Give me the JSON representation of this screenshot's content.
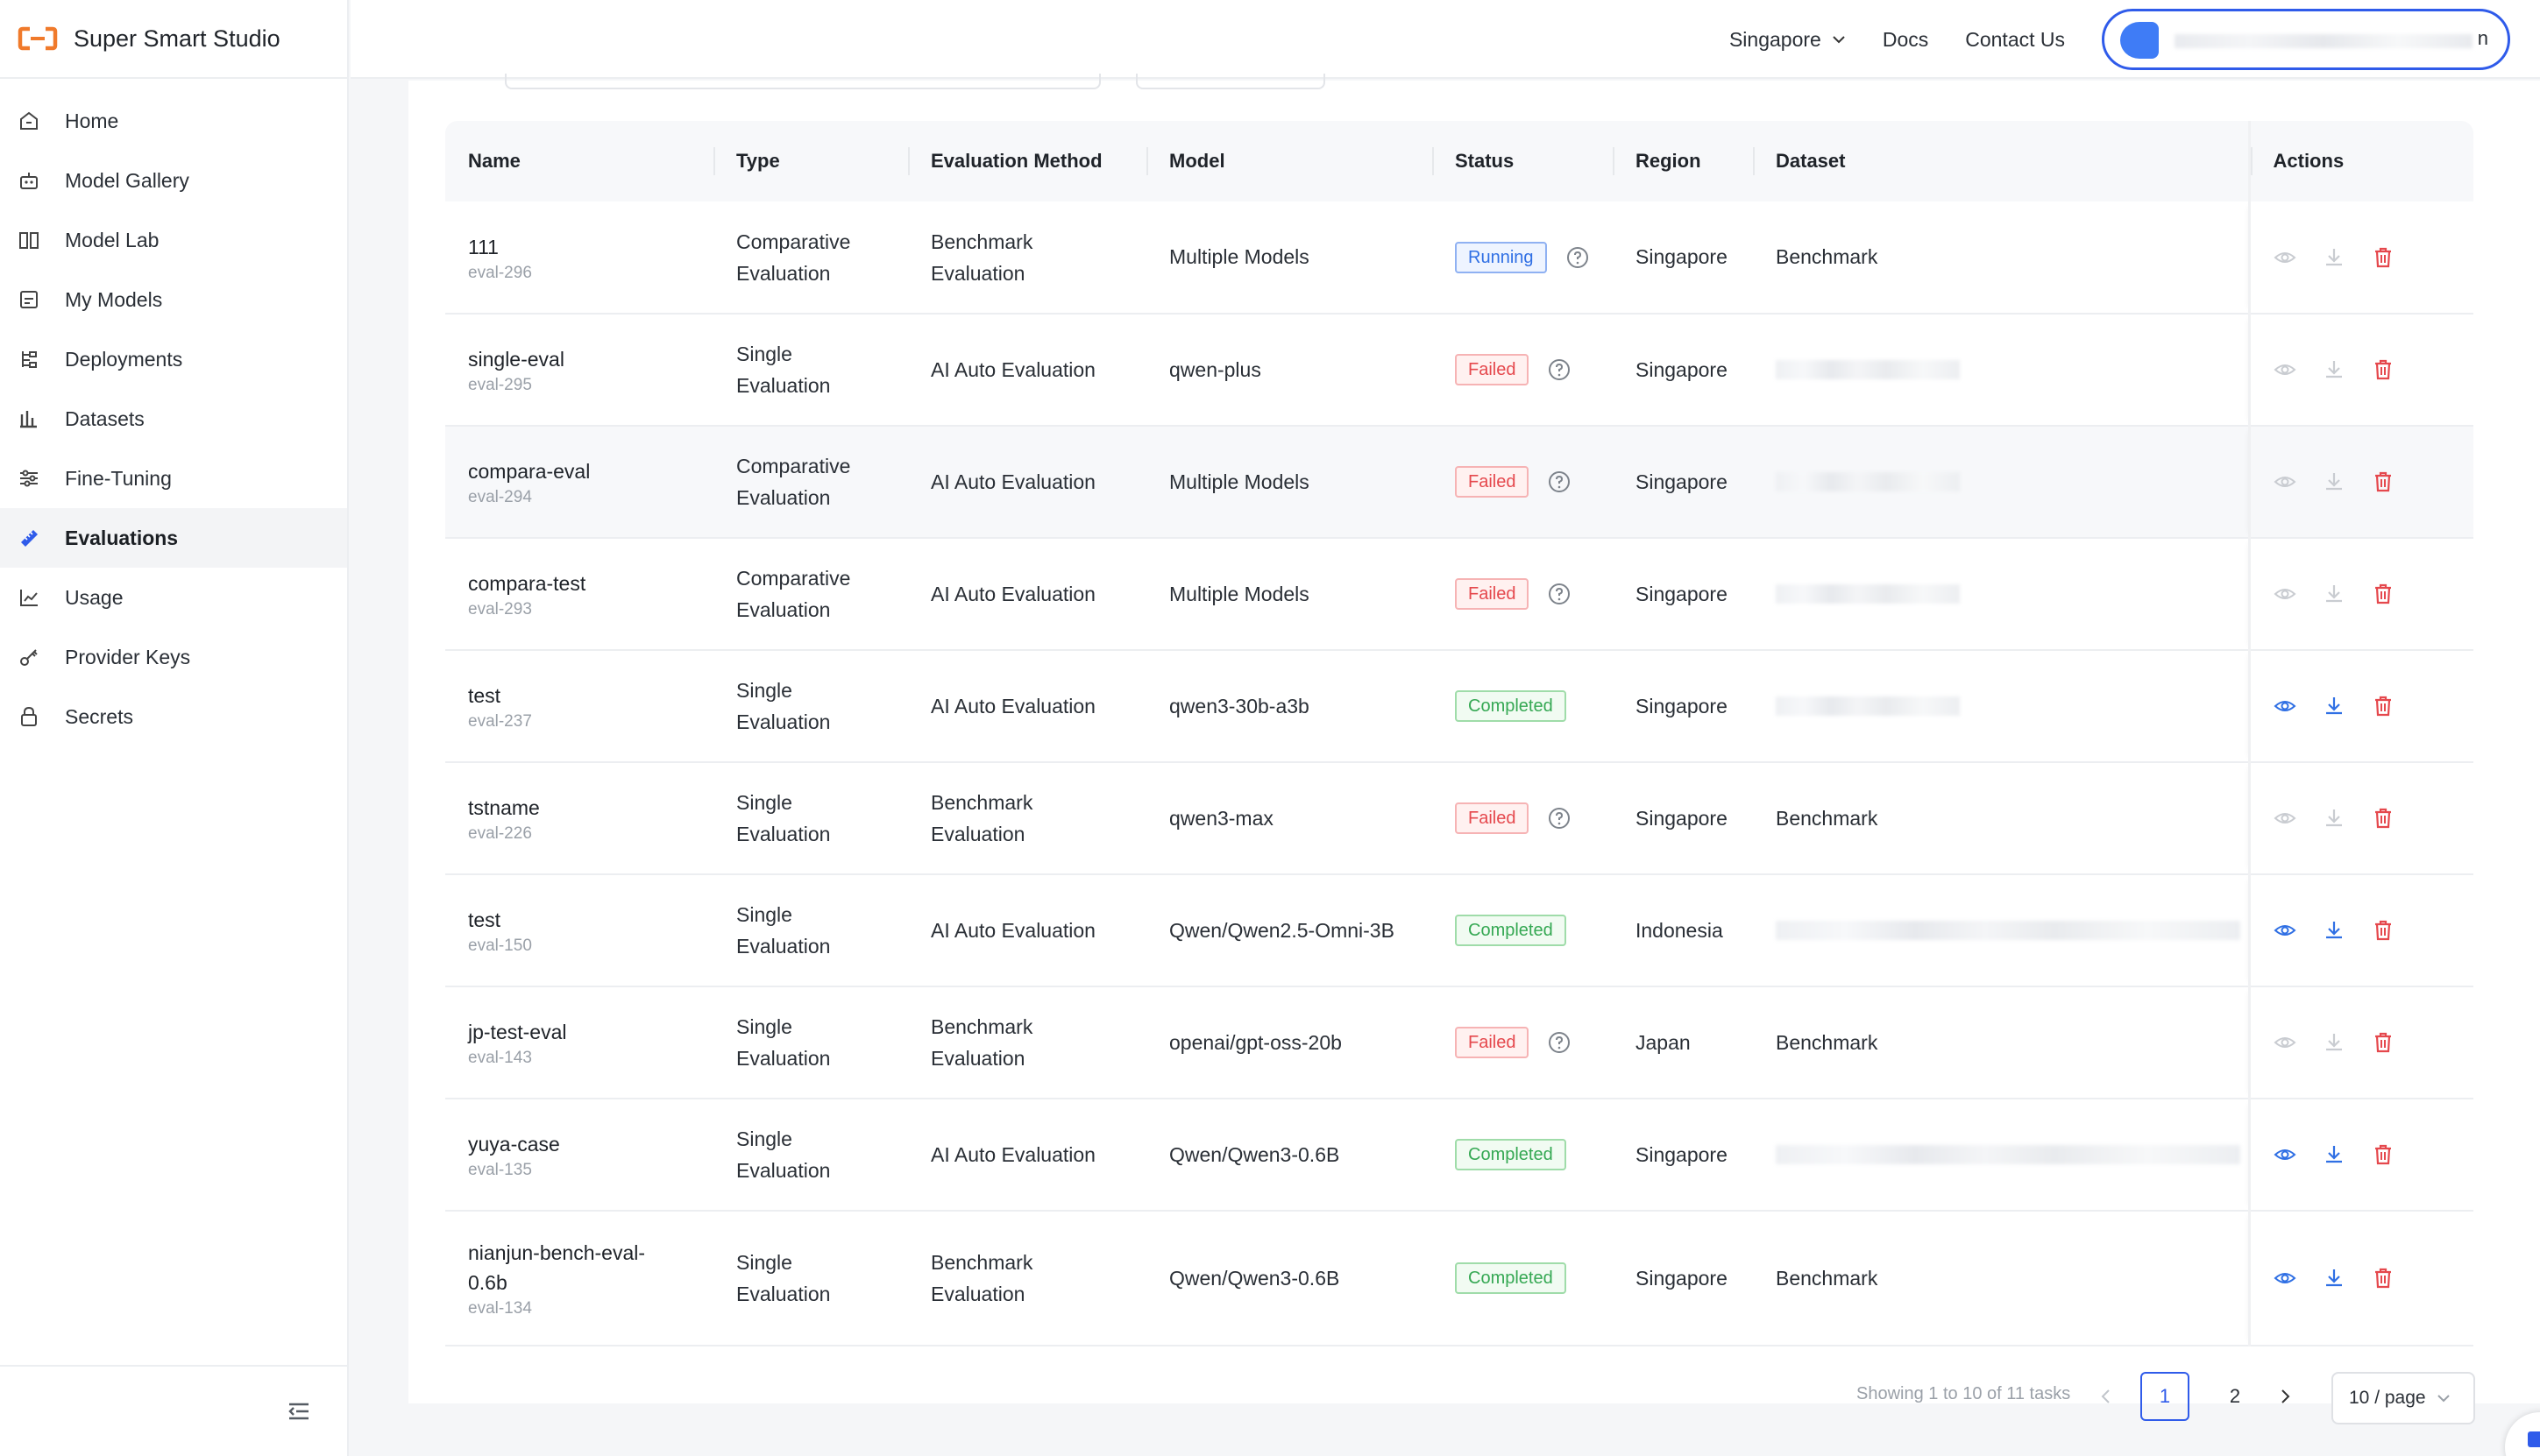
{
  "app": {
    "title": "Super Smart Studio"
  },
  "sidebar": {
    "items": [
      {
        "label": "Home",
        "icon": "home-icon"
      },
      {
        "label": "Model Gallery",
        "icon": "robot-icon"
      },
      {
        "label": "Model Lab",
        "icon": "book-icon"
      },
      {
        "label": "My Models",
        "icon": "model-icon"
      },
      {
        "label": "Deployments",
        "icon": "deploy-icon"
      },
      {
        "label": "Datasets",
        "icon": "chart-icon"
      },
      {
        "label": "Fine-Tuning",
        "icon": "sliders-icon"
      },
      {
        "label": "Evaluations",
        "icon": "ruler-icon",
        "active": true
      },
      {
        "label": "Usage",
        "icon": "usage-icon"
      },
      {
        "label": "Provider Keys",
        "icon": "key-icon"
      },
      {
        "label": "Secrets",
        "icon": "lock-icon"
      }
    ]
  },
  "header": {
    "region": "Singapore",
    "docs": "Docs",
    "contact": "Contact Us",
    "user_tail": "n"
  },
  "table": {
    "columns": [
      "Name",
      "Type",
      "Evaluation Method",
      "Model",
      "Status",
      "Region",
      "Dataset",
      "Actions"
    ],
    "rows": [
      {
        "name": "111",
        "id": "eval-296",
        "type": "Comparative Evaluation",
        "type1": "Comparative",
        "type2": "Evaluation",
        "method1": "Benchmark",
        "method2": "Evaluation",
        "model": "Multiple Models",
        "status": "Running",
        "region": "Singapore",
        "dataset": "Benchmark"
      },
      {
        "name": "single-eval",
        "id": "eval-295",
        "type1": "Single",
        "type2": "Evaluation",
        "method1": "AI Auto Evaluation",
        "method2": "",
        "model": "qwen-plus",
        "status": "Failed",
        "region": "Singapore",
        "dataset": ""
      },
      {
        "name": "compara-eval",
        "id": "eval-294",
        "type1": "Comparative",
        "type2": "Evaluation",
        "method1": "AI Auto Evaluation",
        "method2": "",
        "model": "Multiple Models",
        "status": "Failed",
        "region": "Singapore",
        "dataset": ""
      },
      {
        "name": "compara-test",
        "id": "eval-293",
        "type1": "Comparative",
        "type2": "Evaluation",
        "method1": "AI Auto Evaluation",
        "method2": "",
        "model": "Multiple Models",
        "status": "Failed",
        "region": "Singapore",
        "dataset": ""
      },
      {
        "name": "test",
        "id": "eval-237",
        "type1": "Single",
        "type2": "Evaluation",
        "method1": "AI Auto Evaluation",
        "method2": "",
        "model": "qwen3-30b-a3b",
        "status": "Completed",
        "region": "Singapore",
        "dataset": ""
      },
      {
        "name": "tstname",
        "id": "eval-226",
        "type1": "Single",
        "type2": "Evaluation",
        "method1": "Benchmark",
        "method2": "Evaluation",
        "model": "qwen3-max",
        "status": "Failed",
        "region": "Singapore",
        "dataset": "Benchmark"
      },
      {
        "name": "test",
        "id": "eval-150",
        "type1": "Single",
        "type2": "Evaluation",
        "method1": "AI Auto Evaluation",
        "method2": "",
        "model": "Qwen/Qwen2.5-Omni-3B",
        "status": "Completed",
        "region": "Indonesia",
        "dataset": ""
      },
      {
        "name": "jp-test-eval",
        "id": "eval-143",
        "type1": "Single",
        "type2": "Evaluation",
        "method1": "Benchmark",
        "method2": "Evaluation",
        "model": "openai/gpt-oss-20b",
        "status": "Failed",
        "region": "Japan",
        "dataset": "Benchmark"
      },
      {
        "name": "yuya-case",
        "id": "eval-135",
        "type1": "Single",
        "type2": "Evaluation",
        "method1": "AI Auto Evaluation",
        "method2": "",
        "model": "Qwen/Qwen3-0.6B",
        "status": "Completed",
        "region": "Singapore",
        "dataset": ""
      },
      {
        "name": "nianjun-bench-eval-0.6b",
        "name1": "nianjun-bench-eval-",
        "name2": "0.6b",
        "id": "eval-134",
        "type1": "Single",
        "type2": "Evaluation",
        "method1": "Benchmark",
        "method2": "Evaluation",
        "model": "Qwen/Qwen3-0.6B",
        "status": "Completed",
        "region": "Singapore",
        "dataset": "Benchmark"
      }
    ]
  },
  "pagination": {
    "info": "Showing 1 to 10 of 11 tasks",
    "pages": [
      "1",
      "2"
    ],
    "current": "1",
    "page_size": "10 / page"
  },
  "colors": {
    "accent": "#2f5bea",
    "brand": "#f07a2b",
    "running": "#2f6fe4",
    "failed": "#e5484d",
    "completed": "#35a853"
  }
}
